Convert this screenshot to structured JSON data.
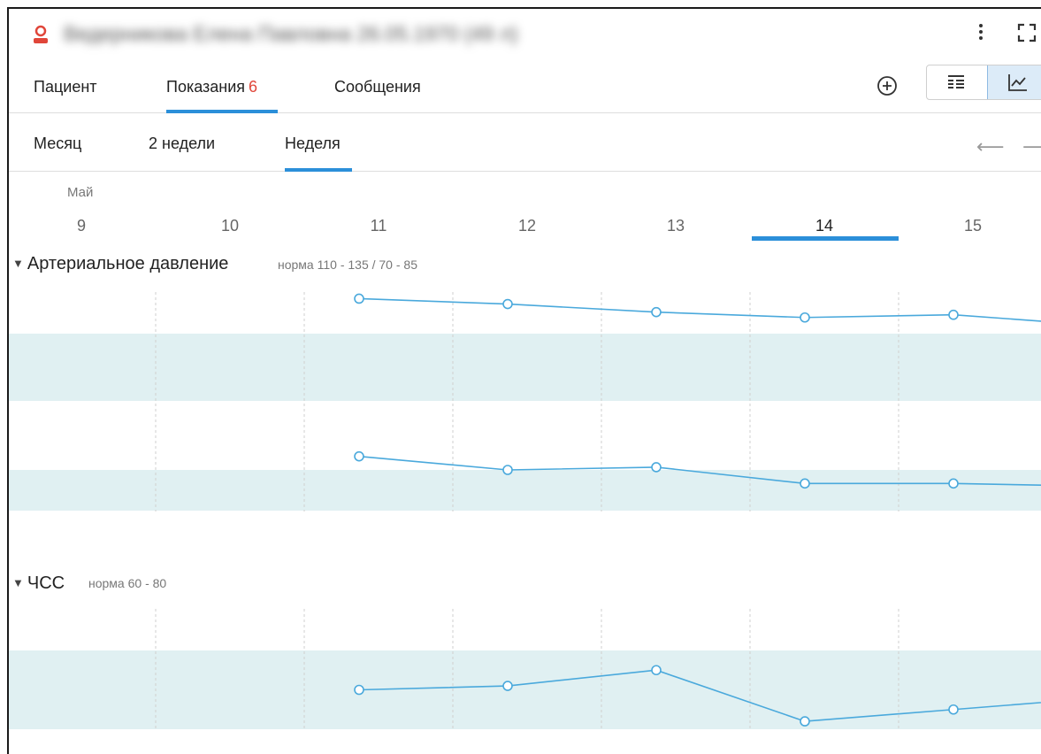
{
  "header": {
    "patient_name": "Ведерникова Елена Павловна 26.05.1970 (49 л)",
    "icons": {
      "user": "user-icon",
      "menu": "kebab-menu-icon",
      "fullscreen": "fullscreen-icon"
    }
  },
  "tabs": [
    {
      "label": "Пациент",
      "badge": ""
    },
    {
      "label": "Показания",
      "badge": "6"
    },
    {
      "label": "Сообщения",
      "badge": ""
    }
  ],
  "active_tab": 1,
  "toolbar": {
    "add_icon": "plus-circle-icon",
    "table_view_icon": "table-view-icon",
    "chart_view_icon": "chart-view-icon",
    "active_view": "chart"
  },
  "periods": [
    {
      "label": "Месяц"
    },
    {
      "label": "2 недели"
    },
    {
      "label": "Неделя"
    }
  ],
  "active_period": 2,
  "nav": {
    "prev_icon": "arrow-left-icon",
    "next_icon": "arrow-right-icon",
    "prev_glyph": "⟵",
    "next_glyph": "⟶"
  },
  "timeline": {
    "month": "Май",
    "days": [
      "9",
      "10",
      "11",
      "12",
      "13",
      "14",
      "15"
    ],
    "current_day_index": 5
  },
  "colors": {
    "accent": "#2b8fd9",
    "line": "#4aa9dc",
    "norm_band": "#e0f0f2",
    "badge": "#e0463a"
  },
  "sections": [
    {
      "title": "Артериальное давление",
      "norm": "норма 110 - 135 / 70 - 85"
    },
    {
      "title": "ЧСС",
      "norm": "норма 60 - 80"
    }
  ],
  "chart_data": [
    {
      "type": "line",
      "x": [
        "9",
        "10",
        "11",
        "12",
        "13",
        "14",
        "15"
      ],
      "series": [
        {
          "name": "",
          "values": [
            null,
            148,
            146,
            143,
            141,
            142,
            138
          ]
        },
        {
          "name": "",
          "values": [
            null,
            90,
            85,
            86,
            80,
            80,
            79
          ]
        }
      ],
      "norm_bands": [
        [
          110,
          135
        ],
        [
          70,
          85
        ]
      ]
    },
    {
      "type": "line",
      "x": [
        "9",
        "10",
        "11",
        "12",
        "13",
        "14",
        "15"
      ],
      "series": [
        {
          "name": "",
          "values": [
            null,
            70,
            71,
            75,
            62,
            65,
            68
          ]
        }
      ],
      "norm_bands": [
        [
          60,
          80
        ]
      ]
    }
  ]
}
